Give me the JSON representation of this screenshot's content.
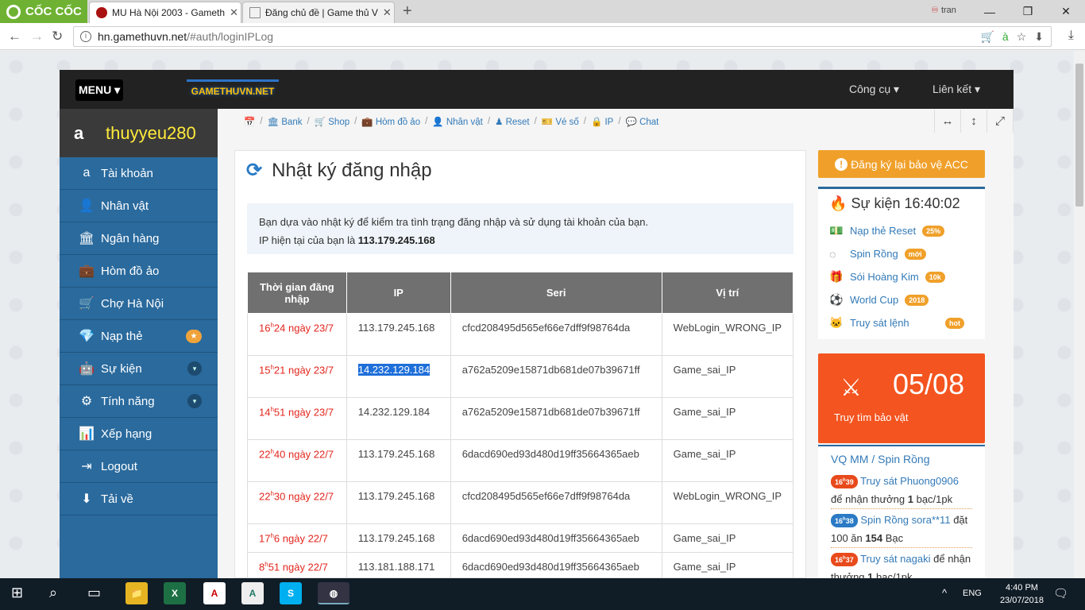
{
  "browser": {
    "brand": "CỐC CỐC",
    "tabs": [
      {
        "title": "MU Hà Nội 2003 - Gameth",
        "active": true
      },
      {
        "title": "Đăng chủ đề | Game thủ V",
        "active": false
      }
    ],
    "profile": "tran",
    "url_host": "hn.gamethuvn.net",
    "url_path": "/#auth/loginIPLog"
  },
  "site": {
    "menu_label": "MENU ▾",
    "logo_text": "GAMETHUVN.NET",
    "top_links": [
      "Công cụ ▾",
      "Liên kết ▾"
    ],
    "username": "thuyyeu280",
    "sidebar": [
      {
        "icon": "amazon-icon",
        "glyph": "a",
        "label": "Tài khoản"
      },
      {
        "icon": "user-icon",
        "glyph": "👤",
        "label": "Nhân vật"
      },
      {
        "icon": "bank-icon",
        "glyph": "🏛",
        "label": "Ngân hàng"
      },
      {
        "icon": "briefcase-icon",
        "glyph": "💼",
        "label": "Hòm đồ ảo"
      },
      {
        "icon": "cart-icon",
        "glyph": "🛒",
        "label": "Chợ Hà Nội"
      },
      {
        "icon": "diamond-icon",
        "glyph": "💎",
        "label": "Nạp thẻ",
        "badge": "★"
      },
      {
        "icon": "android-icon",
        "glyph": "🤖",
        "label": "Sự kiện",
        "chevron": true
      },
      {
        "icon": "cogs-icon",
        "glyph": "⚙",
        "label": "Tính năng",
        "chevron": true
      },
      {
        "icon": "bar-chart-icon",
        "glyph": "📊",
        "label": "Xếp hạng"
      },
      {
        "icon": "logout-icon",
        "glyph": "⇥",
        "label": "Logout"
      },
      {
        "icon": "download-icon",
        "glyph": "⬇",
        "label": "Tải về"
      }
    ],
    "breadcrumbs": [
      "Bank",
      "Shop",
      "Hòm đồ ảo",
      "Nhân vật",
      "Reset",
      "Vé số",
      "IP",
      "Chat"
    ]
  },
  "log": {
    "title": "Nhật ký đăng nhập",
    "info_line1": "Bạn dựa vào nhật ký để kiểm tra tình trạng đăng nhập và sử dụng tài khoản của bạn.",
    "info_line2_prefix": "IP hiện tại của bạn là ",
    "current_ip": "113.179.245.168",
    "columns": [
      "Thời gian đăng nhập",
      "IP",
      "Seri",
      "Vị trí"
    ],
    "rows": [
      {
        "h": "16",
        "rest": "24 ngày 23/7",
        "ip": "113.179.245.168",
        "seri": "cfcd208495d565ef66e7dff9f98764da",
        "pos": "WebLogin_WRONG_IP"
      },
      {
        "h": "15",
        "rest": "21 ngày 23/7",
        "ip": "14.232.129.184",
        "seri": "a762a5209e15871db681de07b39671ff",
        "pos": "Game_sai_IP",
        "selected": true
      },
      {
        "h": "14",
        "rest": "51 ngày 23/7",
        "ip": "14.232.129.184",
        "seri": "a762a5209e15871db681de07b39671ff",
        "pos": "Game_sai_IP"
      },
      {
        "h": "22",
        "rest": "40 ngày 22/7",
        "ip": "113.179.245.168",
        "seri": "6dacd690ed93d480d19ff35664365aeb",
        "pos": "Game_sai_IP"
      },
      {
        "h": "22",
        "rest": "30 ngày 22/7",
        "ip": "113.179.245.168",
        "seri": "cfcd208495d565ef66e7dff9f98764da",
        "pos": "WebLogin_WRONG_IP"
      },
      {
        "h": "17",
        "rest": "6 ngày 22/7",
        "ip": "113.179.245.168",
        "seri": "6dacd690ed93d480d19ff35664365aeb",
        "pos": "Game_sai_IP"
      },
      {
        "h": "8",
        "rest": "51 ngày 22/7",
        "ip": "113.181.188.171",
        "seri": "6dacd690ed93d480d19ff35664365aeb",
        "pos": "Game_sai_IP"
      }
    ]
  },
  "right": {
    "register_btn": "Đăng ký lại bảo vệ ACC",
    "events_title": "Sự kiện 16:40:02",
    "events": [
      {
        "label": "Nạp thẻ Reset",
        "badge": "25%"
      },
      {
        "label": "Spin Rồng",
        "badge": "mới"
      },
      {
        "label": "Sói Hoàng Kim",
        "badge": "10k"
      },
      {
        "label": "World Cup",
        "badge": "2018"
      },
      {
        "label": "Truy sát lệnh",
        "badge": "hot"
      }
    ],
    "treasure_count": "05/08",
    "treasure_label": "Truy tìm bảo vật",
    "vq_title_a": "VQ MM",
    "vq_title_b": "Spin Rồng",
    "feed": [
      {
        "time_h": "16",
        "time_m": "39",
        "link": "Truy sát Phuong0906",
        "text_a": "để nhận thưởng ",
        "bold": "1",
        "text_b": " bạc/1pk"
      },
      {
        "time_h": "16",
        "time_m": "38",
        "link": "Spin Rồng sora**11",
        "text_a": "đặt 100 ăn ",
        "bold": "154",
        "text_b": " Bạc"
      },
      {
        "time_h": "16",
        "time_m": "37",
        "link": "Truy sát nagaki",
        "text_a": " để nhận thưởng ",
        "bold": "1",
        "text_b": " bạc/1pk"
      }
    ]
  },
  "taskbar": {
    "lang": "ENG",
    "time": "4:40 PM",
    "date": "23/07/2018"
  }
}
